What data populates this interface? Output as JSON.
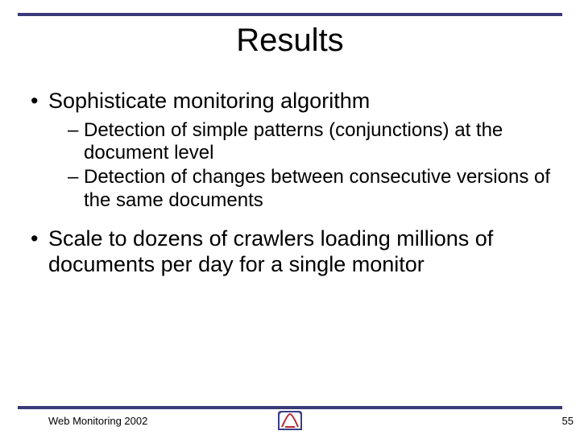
{
  "title": "Results",
  "bullets": [
    {
      "text": "Sophisticate monitoring algorithm",
      "sub": [
        "Detection of simple patterns (conjunctions) at the document level",
        "Detection of changes between consecutive versions of the same documents"
      ]
    },
    {
      "text": "Scale to dozens of crawlers loading millions of documents per day for a single monitor",
      "sub": []
    }
  ],
  "footer": {
    "left": "Web Monitoring 2002",
    "page": "55"
  }
}
